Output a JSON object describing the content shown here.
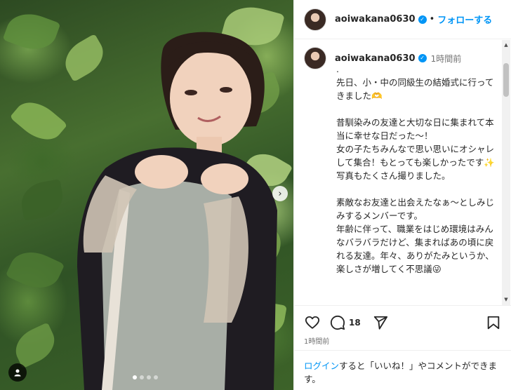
{
  "post": {
    "username": "aoiwakana0630",
    "follow_label": "フォローする",
    "separator": "•",
    "time_ago": "1時間前",
    "caption": ".\n先日、小・中の同級生の結婚式に行ってきました🫶\n\n昔馴染みの友達と大切な日に集まれて本当に幸せな日だった〜！\n女の子たちみんなで思い思いにオシャレして集合！もとっても楽しかったです✨\n写真もたくさん撮りました。\n\n素敵なお友達と出会えたなぁ〜としみじみするメンバーです。\n年齢に伴って、職業をはじめ環境はみんなバラバラだけど、集まればあの頃に戻れる友達。年々、ありがたみというか、楽しさが増してく不思議😜",
    "comment_count": "18",
    "post_time": "1時間前"
  },
  "login_prompt": {
    "link_text": "ログイン",
    "rest_text": "すると「いいね！」やコメントができます。"
  },
  "carousel": {
    "current": 1,
    "total": 4
  },
  "icons": {
    "verified": "verified-badge-icon",
    "like": "heart-icon",
    "comment": "comment-bubble-icon",
    "share": "paper-plane-icon",
    "save": "bookmark-icon",
    "more": "plus-circle-icon",
    "next": "chevron-right-icon",
    "tag": "user-tag-icon"
  },
  "colors": {
    "accent": "#0095f6",
    "text": "#262626",
    "muted": "#737373"
  }
}
